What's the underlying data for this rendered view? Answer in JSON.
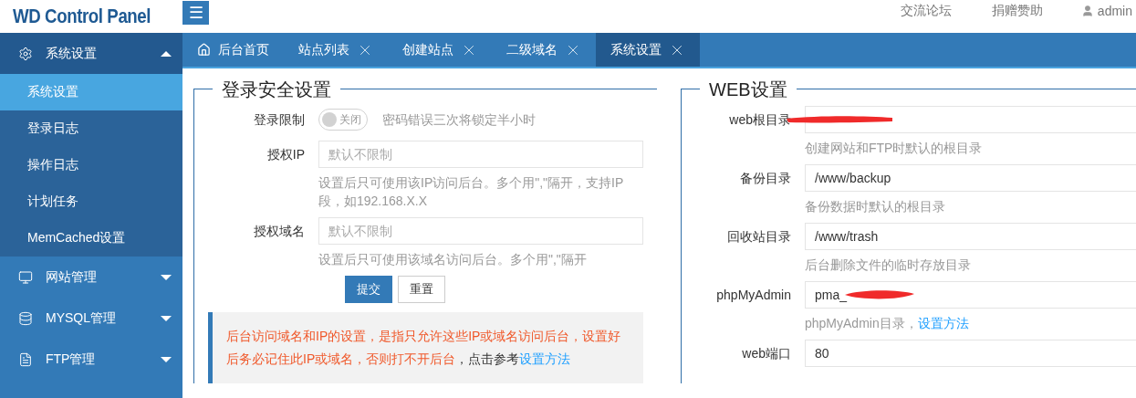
{
  "header": {
    "logo": "WD Control Panel",
    "menu_icon": "☰",
    "links": [
      "交流论坛",
      "捐赠赞助"
    ],
    "user": "admin"
  },
  "sidebar": [
    {
      "label": "系统设置",
      "expanded": true,
      "children": [
        {
          "label": "系统设置",
          "selected": true
        },
        {
          "label": "登录日志",
          "selected": false
        },
        {
          "label": "操作日志",
          "selected": false
        },
        {
          "label": "计划任务",
          "selected": false
        },
        {
          "label": "MemCached设置",
          "selected": false
        }
      ]
    },
    {
      "label": "网站管理",
      "expanded": false
    },
    {
      "label": "MYSQL管理",
      "expanded": false
    },
    {
      "label": "FTP管理",
      "expanded": false
    }
  ],
  "tabs": [
    {
      "label": "后台首页",
      "kind": "home",
      "selected": false
    },
    {
      "label": "站点列表",
      "kind": "closable",
      "selected": false
    },
    {
      "label": "创建站点",
      "kind": "closable",
      "selected": false
    },
    {
      "label": "二级域名",
      "kind": "closable",
      "selected": false
    },
    {
      "label": "系统设置",
      "kind": "closable",
      "selected": true
    }
  ],
  "login_security": {
    "title": "登录安全设置",
    "rows": [
      {
        "kind": "toggle",
        "label": "登录限制",
        "on": false,
        "toggle_text": "关闭",
        "hint": "密码错误三次将锁定半小时"
      },
      {
        "kind": "field",
        "label": "授权IP",
        "placeholder": "默认不限制",
        "help": "设置后只可使用该IP访问后台。多个用\",\"隔开，支持IP段，如192.168.X.X"
      },
      {
        "kind": "field",
        "label": "授权域名",
        "placeholder": "默认不限制",
        "help": "设置后只可使用该域名访问后台。多个用\",\"隔开"
      }
    ],
    "buttons": [
      {
        "label": "提交",
        "kind": "primary"
      },
      {
        "label": "重置",
        "kind": "default"
      }
    ],
    "notice": {
      "warning": "后台访问域名和IP的设置，是指只允许这些IP或域名访问后台，设置好后务必记住此IP或域名，否则打不开后台",
      "text": "，点击参考",
      "link": "设置方法"
    }
  },
  "web_settings": {
    "title": "WEB设置",
    "rows": [
      {
        "label": "web根目录",
        "redacted": true,
        "help": "创建网站和FTP时默认的根目录"
      },
      {
        "label": "备份目录",
        "value": "/www/backup",
        "help": "备份数据时默认的根目录"
      },
      {
        "label": "回收站目录",
        "value": "/www/trash",
        "help": "后台删除文件的临时存放目录"
      },
      {
        "label": "phpMyAdmin",
        "value": "pma_",
        "redacted": true,
        "help": "phpMyAdmin目录，",
        "help_link": "设置方法"
      },
      {
        "label": "web端口",
        "value": "80"
      }
    ]
  }
}
